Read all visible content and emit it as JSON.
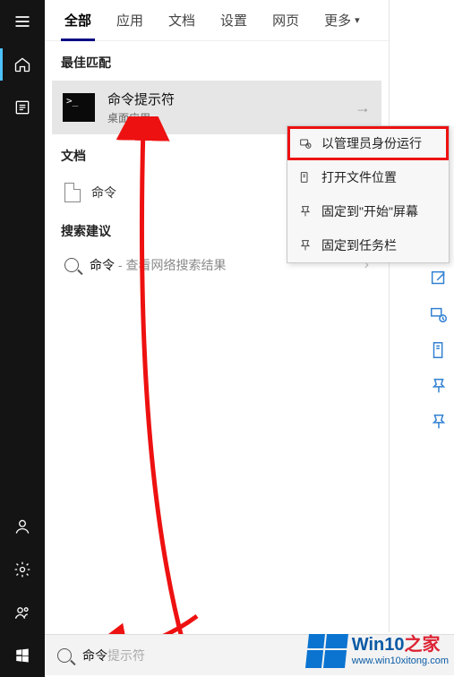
{
  "tabs": {
    "all": "全部",
    "apps": "应用",
    "docs": "文档",
    "settings": "设置",
    "web": "网页",
    "more": "更多"
  },
  "sections": {
    "best_match": "最佳匹配",
    "documents": "文档",
    "suggestions": "搜索建议"
  },
  "best_match": {
    "title": "命令提示符",
    "subtitle": "桌面应用",
    "prompt_glyph": ">_"
  },
  "documents": {
    "items": [
      "命令"
    ]
  },
  "suggestions": {
    "query": "命令",
    "hint": " - 查看网络搜索结果"
  },
  "context_menu": {
    "run_admin": "以管理员身份运行",
    "open_location": "打开文件位置",
    "pin_start": "固定到\"开始\"屏幕",
    "pin_taskbar": "固定到任务栏"
  },
  "search": {
    "typed": "命令",
    "ghost": "提示符"
  },
  "watermark": {
    "brand": "Win10",
    "zhi": "之家",
    "url": "www.win10xitong.com"
  }
}
